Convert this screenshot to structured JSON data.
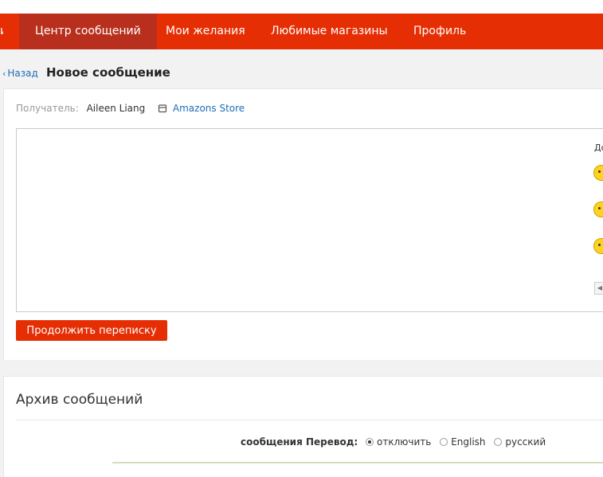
{
  "nav": {
    "items": [
      {
        "label": "и"
      },
      {
        "label": "Центр сообщений"
      },
      {
        "label": "Мои желания"
      },
      {
        "label": "Любимые магазины"
      },
      {
        "label": "Профиль"
      }
    ],
    "active_index": 1,
    "accent_color": "#e62e04",
    "active_color": "#b8301d"
  },
  "header": {
    "back_label": "Назад",
    "title": "Новое сообщение"
  },
  "compose": {
    "recipient_label": "Получатель:",
    "recipient_name": "Aileen Liang",
    "store_icon": "store-icon",
    "store_name": "Amazons Store",
    "message_value": "",
    "emoji_panel_title": "До",
    "emojis": [
      "smile-emoji-icon",
      "wink-emoji-icon",
      "laugh-emoji-icon"
    ],
    "continue_label": "Продолжить переписку"
  },
  "archive": {
    "title": "Архив сообщений",
    "translate_label": "сообщения Перевод:",
    "options": [
      "отключить",
      "English",
      "русский"
    ],
    "selected_index": 0
  }
}
